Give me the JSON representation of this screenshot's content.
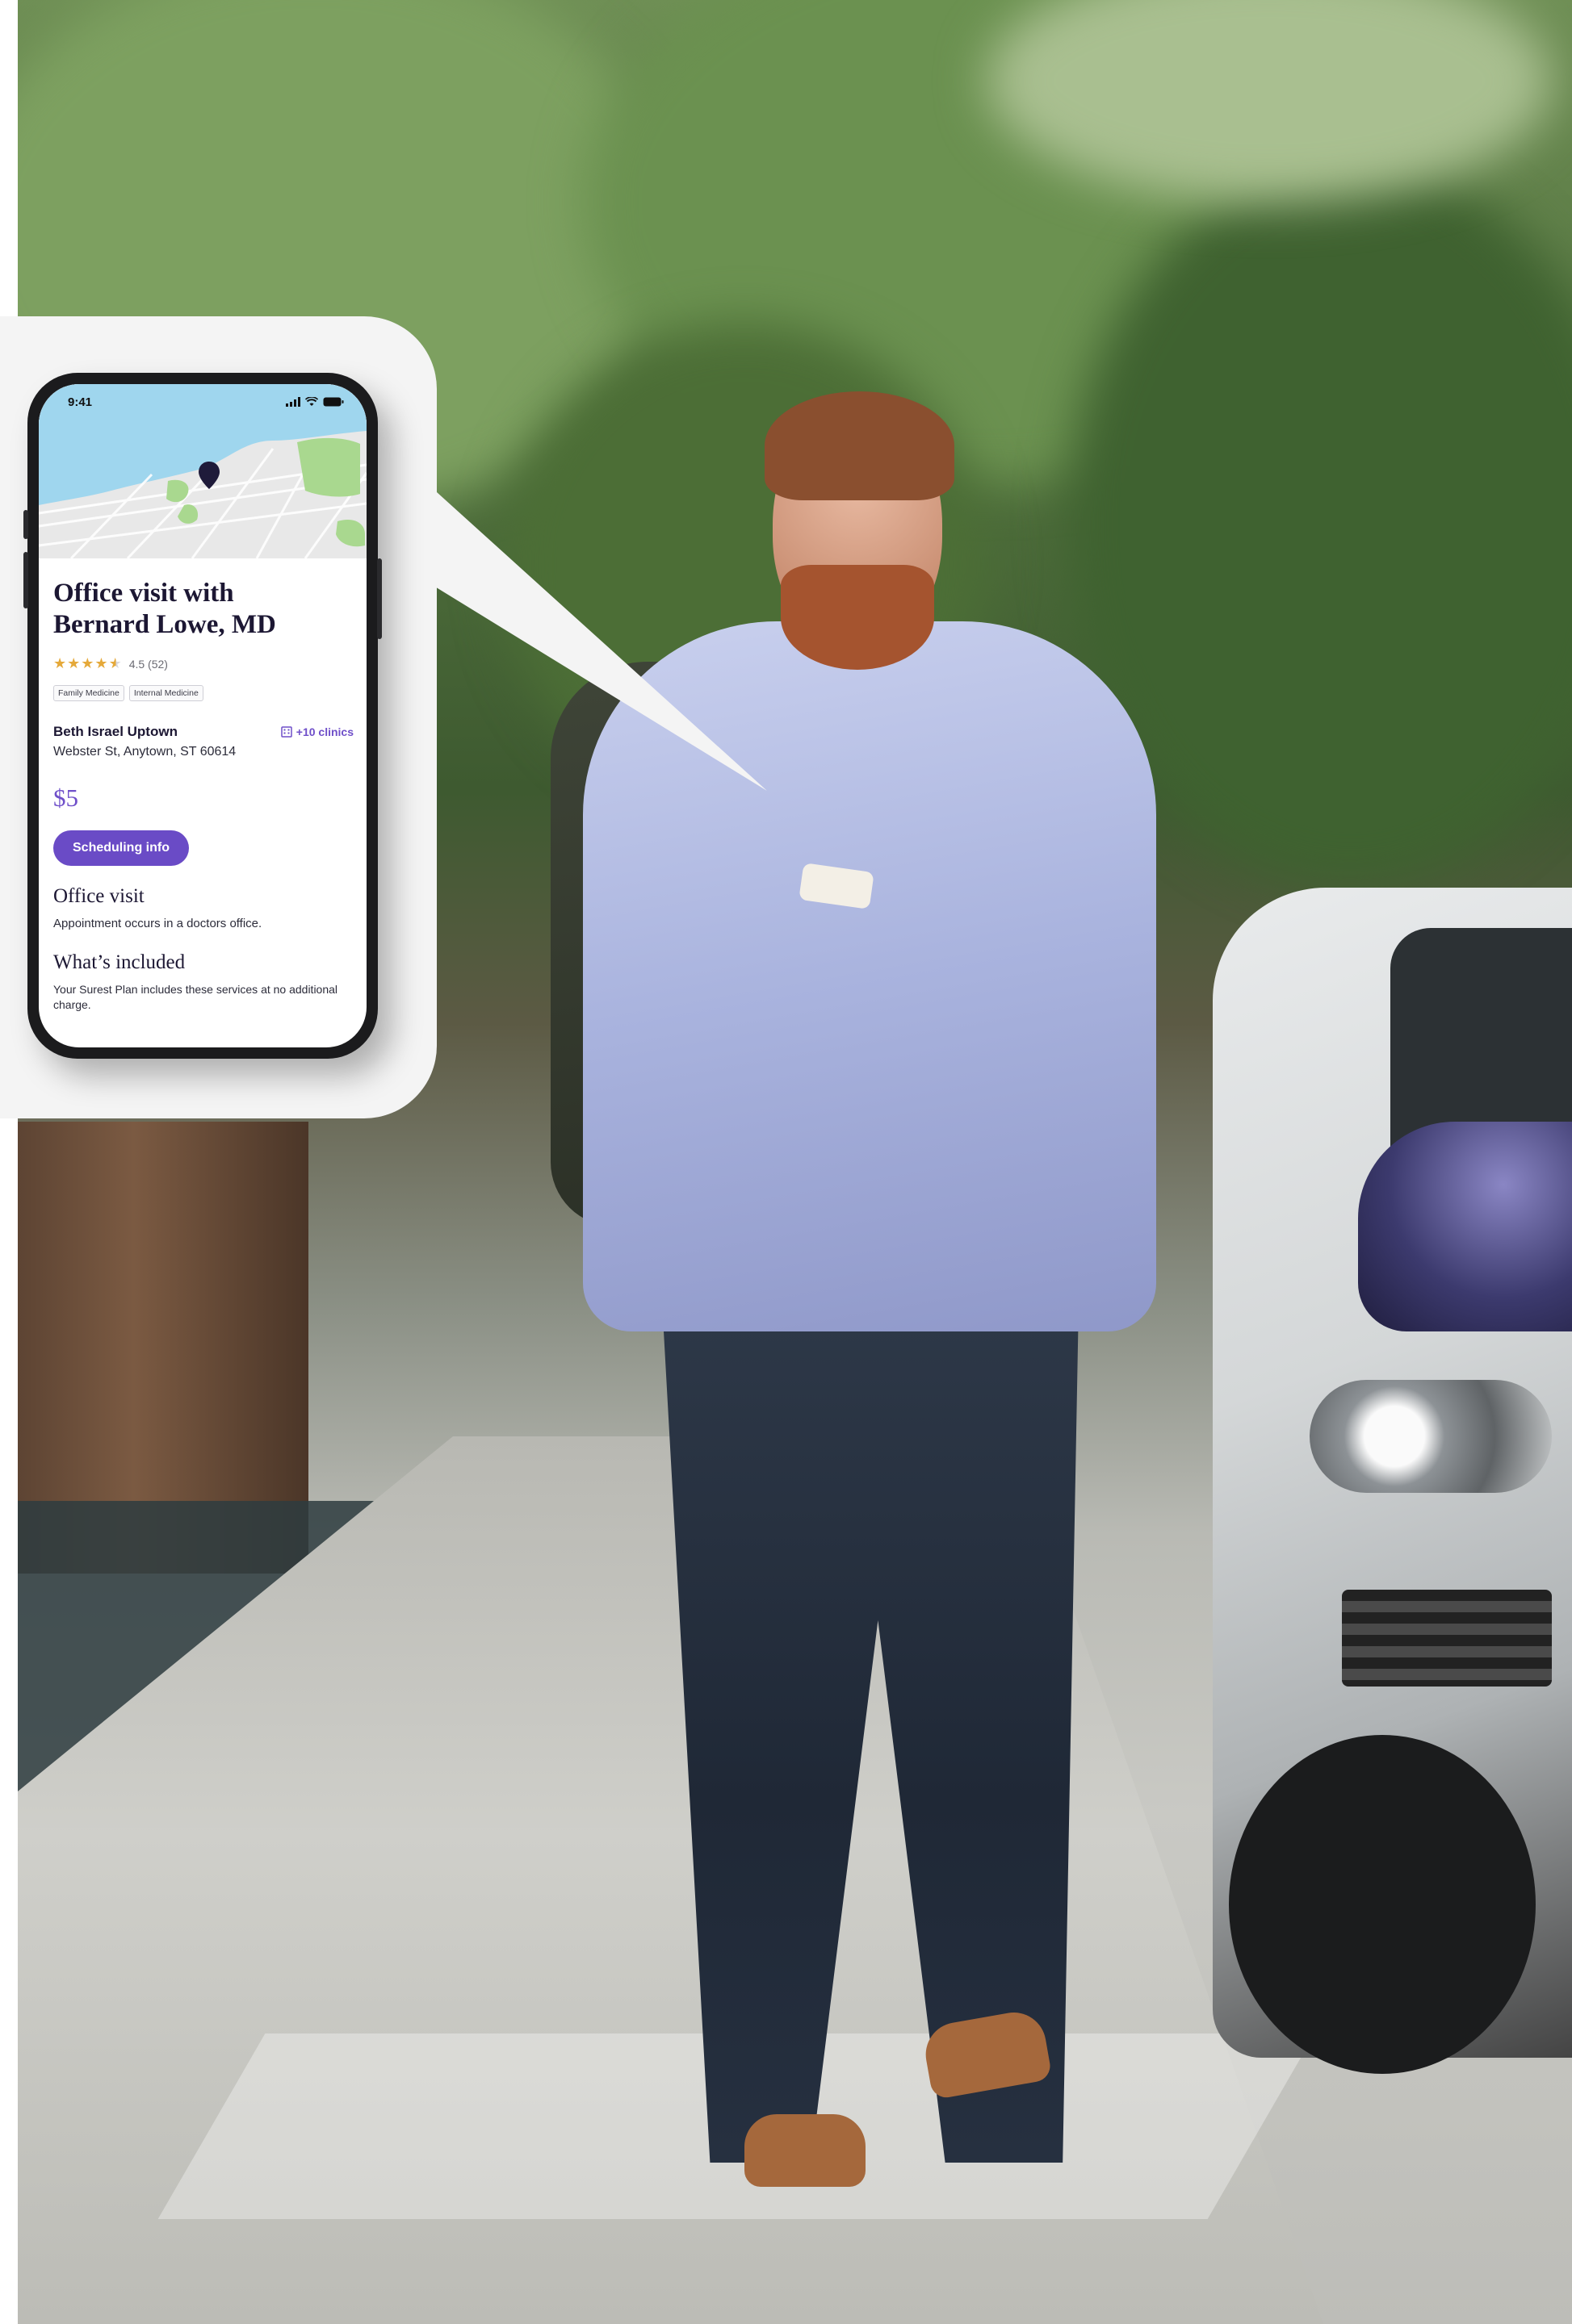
{
  "phone": {
    "status_time": "9:41",
    "listing": {
      "title_line1": "Office visit with",
      "title_line2": "Bernard Lowe, MD",
      "rating_value": 4.5,
      "rating_text": "4.5 (52)",
      "tags": [
        "Family Medicine",
        "Internal Medicine"
      ],
      "clinic_name": "Beth Israel Uptown",
      "more_clinics": "+10 clinics",
      "address": "Webster St, Anytown, ST 60614",
      "price": "$5",
      "scheduling_button": "Scheduling info",
      "office_visit_title": "Office visit",
      "office_visit_text": "Appointment occurs in a doctors office.",
      "included_title": "What’s included",
      "included_text": "Your Surest Plan includes these services at no additional charge."
    }
  },
  "colors": {
    "accent_purple": "#6a4bc6",
    "star_gold": "#e5a93a",
    "map_water": "#9fd6ee",
    "map_park": "#a9d88f",
    "bubble_bg": "#f4f4f4"
  },
  "icons": [
    "signal-icon",
    "wifi-icon",
    "battery-icon",
    "map-pin-icon",
    "building-icon",
    "star-icon"
  ]
}
